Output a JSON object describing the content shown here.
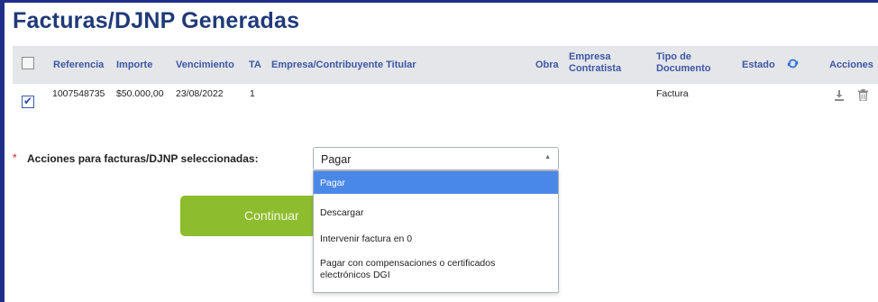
{
  "page": {
    "title": "Facturas/DJNP Generadas"
  },
  "table": {
    "headers": {
      "referencia": "Referencia",
      "importe": "Importe",
      "vencimiento": "Vencimiento",
      "ta": "TA",
      "empresa_titular": "Empresa/Contribuyente Titular",
      "obra": "Obra",
      "empresa_contratista_1": "Empresa",
      "empresa_contratista_2": "Contratista",
      "tipo_doc_1": "Tipo de",
      "tipo_doc_2": "Documento",
      "estado": "Estado",
      "acciones": "Acciones"
    },
    "rows": [
      {
        "checked": true,
        "referencia": "1007548735",
        "importe": "$50.000,00",
        "vencimiento": "23/08/2022",
        "ta": "1",
        "empresa_titular": "",
        "obra": "",
        "empresa_contratista": "",
        "tipo_documento": "Factura",
        "estado": ""
      }
    ]
  },
  "actions": {
    "required_marker": "*",
    "label": "Acciones para facturas/DJNP seleccionadas:",
    "select_value": "Pagar",
    "options": [
      "Pagar",
      "Descargar",
      "Intervenir factura en 0",
      "Pagar con compensaciones o certificados",
      "electrónicos DGI"
    ],
    "continue_label": "Continuar"
  },
  "colors": {
    "title": "#1f3a78",
    "header_text": "#3d57a3",
    "header_bg": "#e4e6ea",
    "continue_bg": "#8dbd2e",
    "selected_option_bg": "#4a88e8"
  }
}
